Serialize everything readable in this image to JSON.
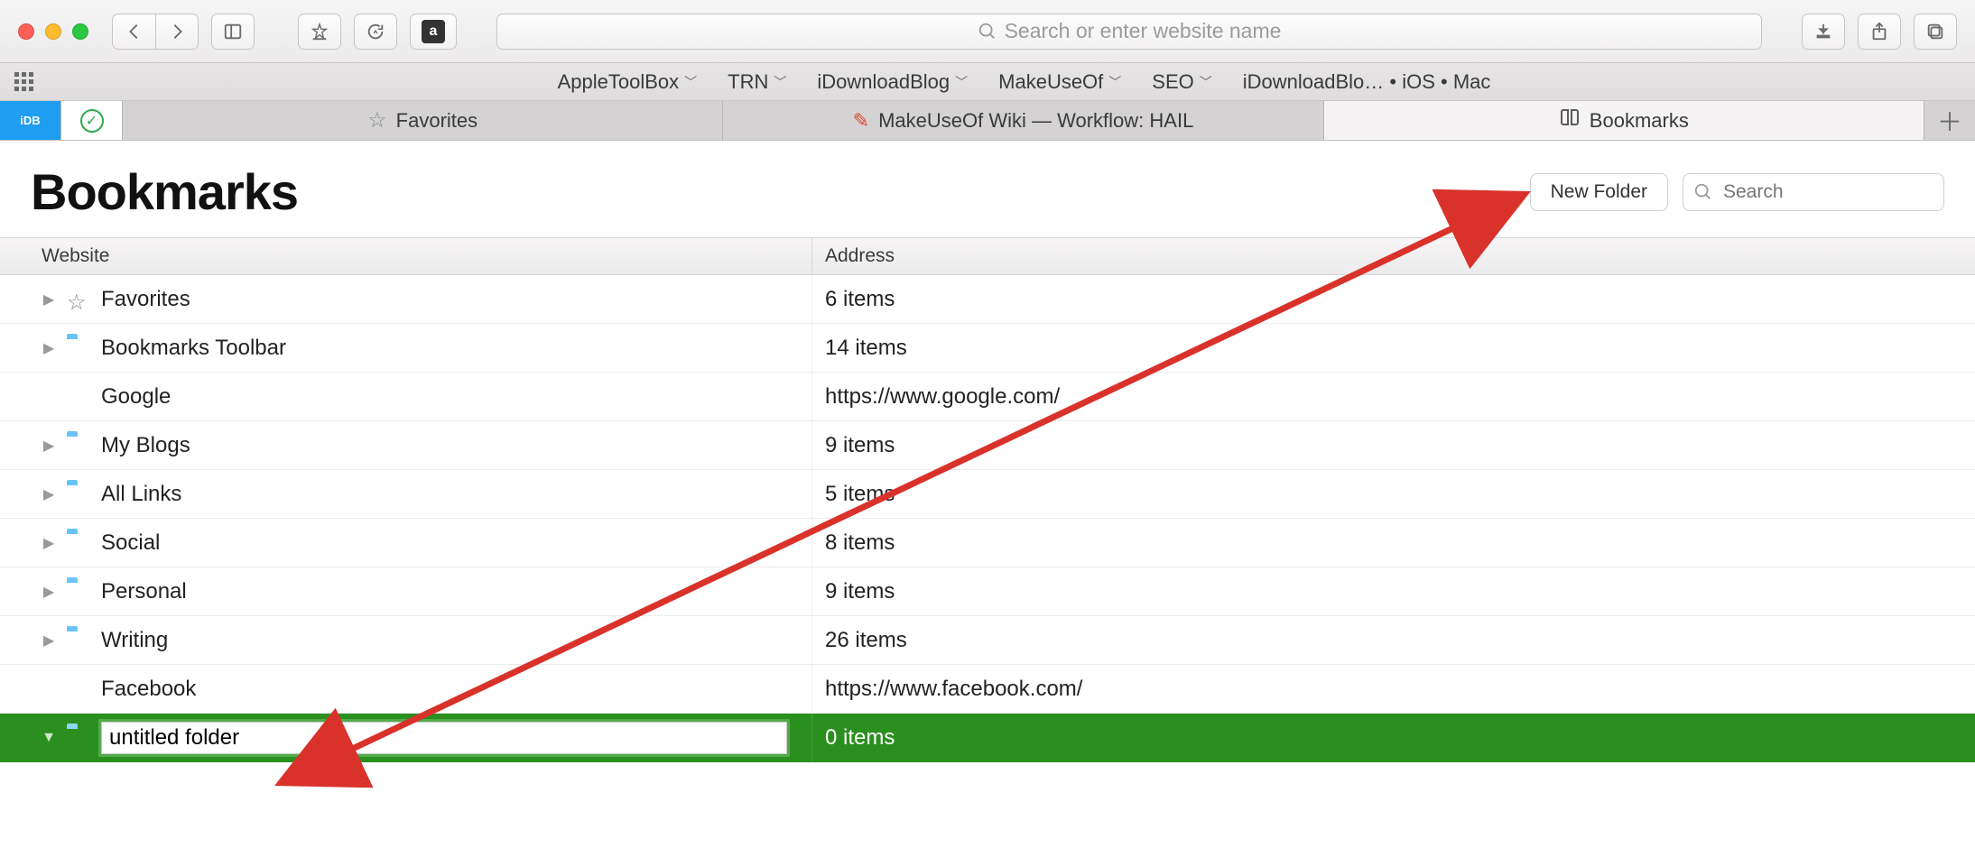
{
  "toolbar": {
    "address_placeholder": "Search or enter website name"
  },
  "favbar": {
    "items": [
      {
        "label": "AppleToolBox",
        "dropdown": true
      },
      {
        "label": "TRN",
        "dropdown": true
      },
      {
        "label": "iDownloadBlog",
        "dropdown": true
      },
      {
        "label": "MakeUseOf",
        "dropdown": true
      },
      {
        "label": "SEO",
        "dropdown": true
      },
      {
        "label": "iDownloadBlo… • iOS • Mac",
        "dropdown": false
      }
    ]
  },
  "tabs": {
    "fav_label": "Favorites",
    "middle_label": "MakeUseOf Wiki — Workflow: HAIL",
    "active_label": "Bookmarks"
  },
  "header": {
    "title": "Bookmarks",
    "new_folder_label": "New Folder",
    "search_placeholder": "Search"
  },
  "columns": {
    "website": "Website",
    "address": "Address"
  },
  "rows": [
    {
      "icon": "star",
      "expandable": true,
      "name": "Favorites",
      "address": "6 items"
    },
    {
      "icon": "folder",
      "expandable": true,
      "name": "Bookmarks Toolbar",
      "address": "14 items"
    },
    {
      "icon": "google",
      "expandable": false,
      "name": "Google",
      "address": "https://www.google.com/"
    },
    {
      "icon": "folder",
      "expandable": true,
      "name": "My Blogs",
      "address": "9 items"
    },
    {
      "icon": "folder",
      "expandable": true,
      "name": "All Links",
      "address": "5 items"
    },
    {
      "icon": "folder",
      "expandable": true,
      "name": "Social",
      "address": "8 items"
    },
    {
      "icon": "folder",
      "expandable": true,
      "name": "Personal",
      "address": "9 items"
    },
    {
      "icon": "folder",
      "expandable": true,
      "name": "Writing",
      "address": "26 items"
    },
    {
      "icon": "globe",
      "expandable": false,
      "name": "Facebook",
      "address": "https://www.facebook.com/"
    }
  ],
  "editing_row": {
    "name": "untitled folder",
    "address": "0 items"
  }
}
